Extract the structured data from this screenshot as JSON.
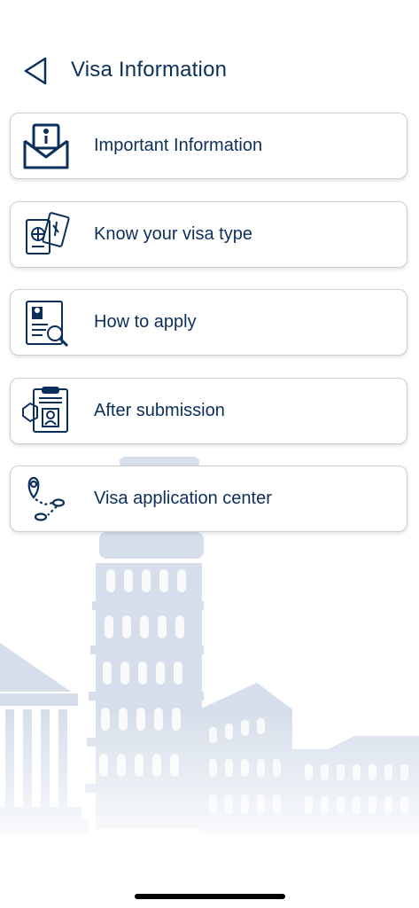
{
  "header": {
    "title": "Visa Information",
    "back_icon": "chevron-left-icon"
  },
  "menu": {
    "items": [
      {
        "label": "Important Information",
        "icon": "envelope-info-icon"
      },
      {
        "label": "Know your visa type",
        "icon": "passport-icon"
      },
      {
        "label": "How to apply",
        "icon": "document-search-icon"
      },
      {
        "label": "After submission",
        "icon": "clipboard-id-icon"
      },
      {
        "label": "Visa application center",
        "icon": "location-route-icon"
      }
    ]
  },
  "colors": {
    "primary": "#0b2f5b",
    "card_border": "#c9ced6",
    "background_art": "#d5deea"
  }
}
